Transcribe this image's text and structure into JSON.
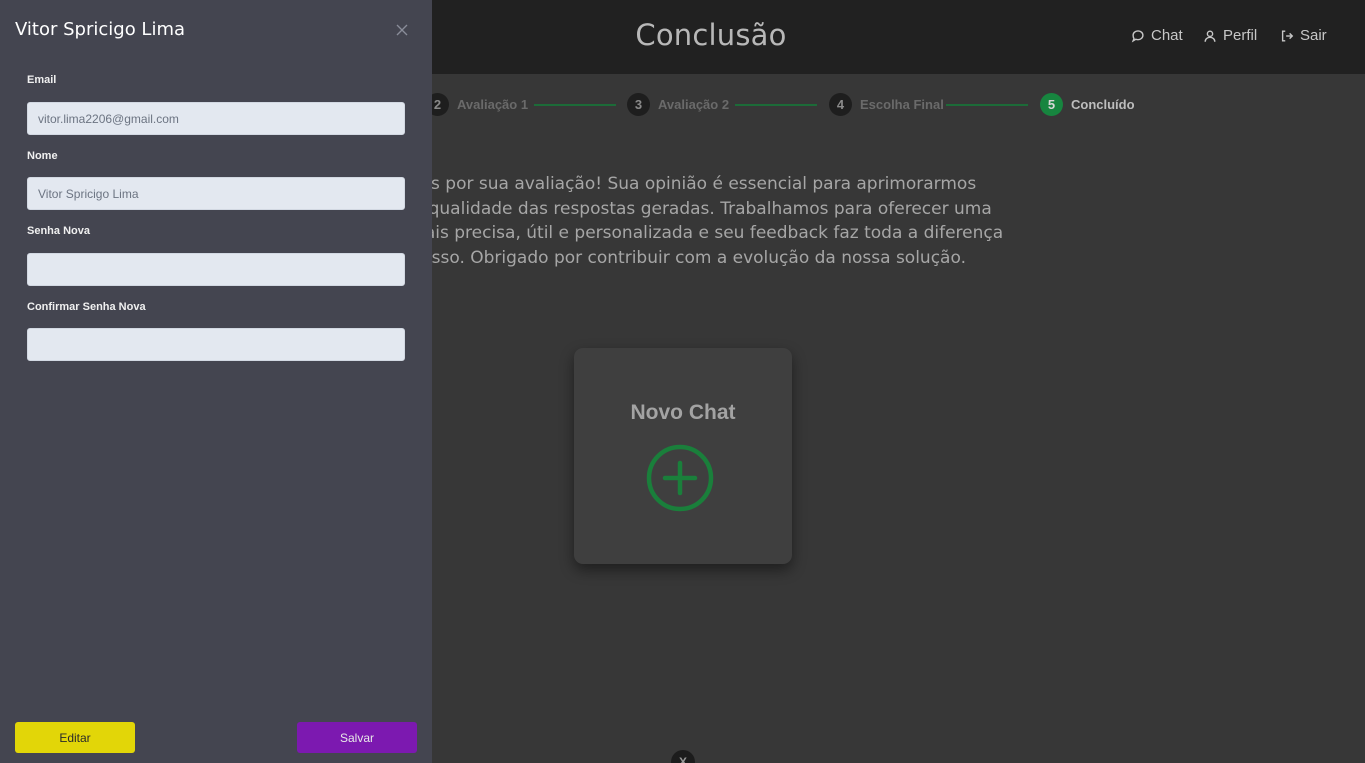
{
  "header": {
    "title": "Conclusão",
    "nav": [
      {
        "label": "Chat",
        "icon": "chat-bubble-icon"
      },
      {
        "label": "Perfil",
        "icon": "user-icon"
      },
      {
        "label": "Sair",
        "icon": "logout-icon"
      }
    ]
  },
  "stepper": {
    "steps": [
      {
        "number": "2",
        "label": "Avaliação 1"
      },
      {
        "number": "3",
        "label": "Avaliação 2"
      },
      {
        "number": "4",
        "label": "Escolha Final"
      },
      {
        "number": "5",
        "label": "Concluído",
        "active": true
      }
    ],
    "active_color": "#17853f"
  },
  "message": {
    "lines": [
      "ecemos por sua avaliação! Sua opinião é essencial para aprimorarmos",
      "gente a qualidade das respostas geradas. Trabalhamos para oferecer uma",
      "da vez mais precisa, útil e personalizada e seu feedback faz toda a diferença",
      "processo. Obrigado por contribuir com a evolução da nossa solução."
    ]
  },
  "chat_card": {
    "title": "Novo Chat",
    "icon": "plus-circle-icon"
  },
  "bottom_close": "X",
  "profile_panel": {
    "title": "Vitor Spricigo Lima",
    "fields": [
      {
        "label": "Email",
        "value": "vitor.lima2206@gmail.com"
      },
      {
        "label": "Nome",
        "value": "Vitor Spricigo Lima"
      },
      {
        "label": "Senha Nova",
        "value": ""
      },
      {
        "label": "Confirmar Senha Nova",
        "value": ""
      }
    ],
    "edit_label": "Editar",
    "save_label": "Salvar",
    "edit_color": "#e2d608",
    "save_color": "#7c19b0"
  }
}
